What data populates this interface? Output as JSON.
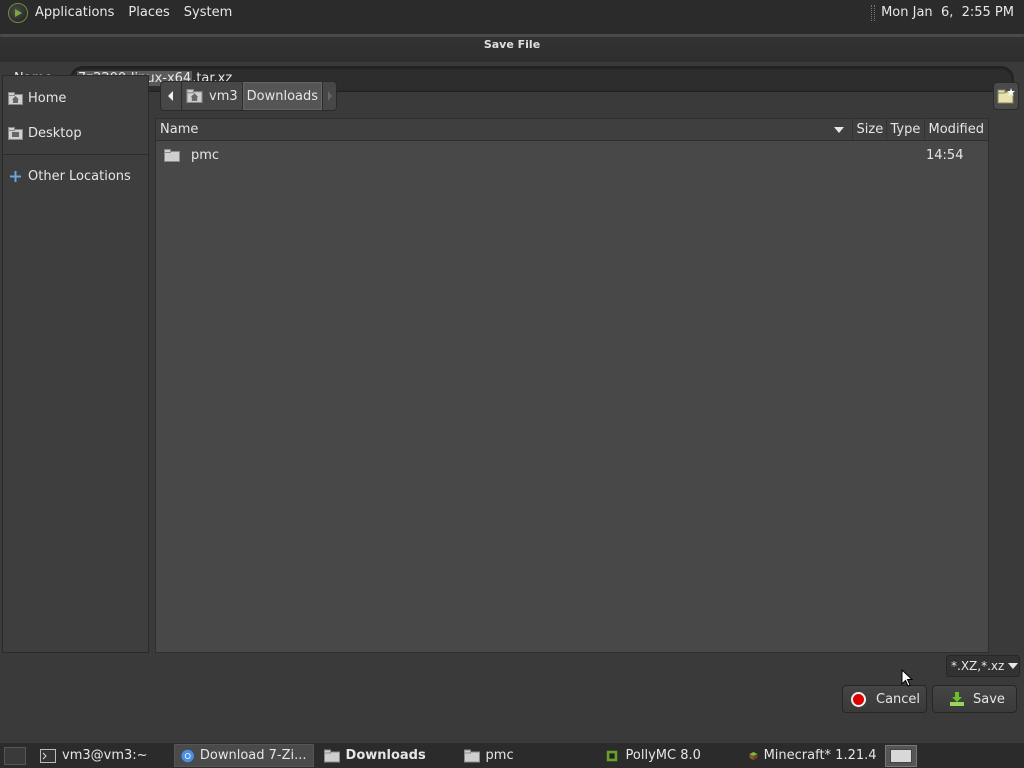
{
  "top_panel": {
    "menus": [
      "Applications",
      "Places",
      "System"
    ],
    "clock": "Mon Jan  6,  2:55 PM"
  },
  "dialog": {
    "title": "Save File",
    "name_label": "Name:",
    "name_value_selected": "7z2200-linux-x64",
    "name_value_rest": ".tar.xz",
    "sidebar": {
      "items": [
        {
          "label": "Home",
          "icon": "home-folder-icon"
        },
        {
          "label": "Desktop",
          "icon": "desktop-folder-icon"
        },
        {
          "label": "Other Locations",
          "icon": "plus-icon"
        }
      ]
    },
    "pathbar": {
      "segments": [
        "vm3",
        "Downloads"
      ]
    },
    "filelist": {
      "columns": [
        "Name",
        "Size",
        "Type",
        "Modified"
      ],
      "rows": [
        {
          "name": "pmc",
          "size": "",
          "type": "",
          "modified": "14:54"
        }
      ]
    },
    "filter": "*.XZ,*.xz",
    "cancel_label": "Cancel",
    "save_label": "Save"
  },
  "taskbar": {
    "tasks": [
      {
        "label": "vm3@vm3:~",
        "icon": "terminal-icon"
      },
      {
        "label": "Download 7-Zi...",
        "icon": "chrome-icon"
      },
      {
        "label": "Downloads",
        "icon": "folder-icon"
      },
      {
        "label": "pmc",
        "icon": "folder-icon"
      },
      {
        "label": "PollyMC 8.0",
        "icon": "pollymc-icon"
      },
      {
        "label": "Minecraft* 1.21.4",
        "icon": "minecraft-icon"
      }
    ]
  }
}
